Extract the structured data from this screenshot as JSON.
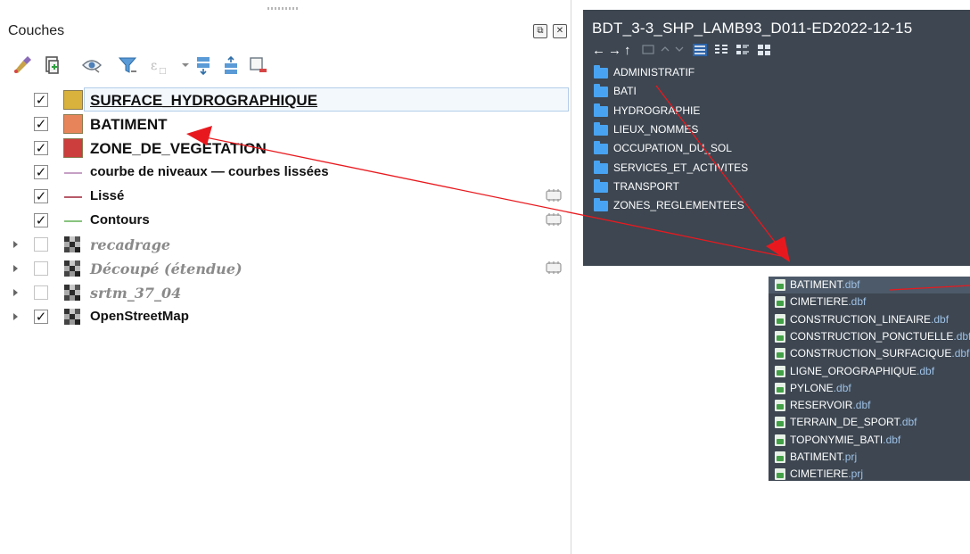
{
  "layers_panel": {
    "title": "Couches",
    "float_button": "⧉",
    "close_button": "✕",
    "layers": [
      {
        "name": "SURFACE_HYDROGRAPHIQUE",
        "checked": true,
        "symbol": "fill",
        "color": "#d8b23c",
        "underline": true,
        "selected": true,
        "expander": false,
        "edit": false
      },
      {
        "name": "BATIMENT",
        "checked": true,
        "symbol": "fill",
        "color": "#e8845a",
        "underline": false,
        "selected": false,
        "expander": false,
        "edit": false
      },
      {
        "name": "ZONE_DE_VEGETATION",
        "checked": true,
        "symbol": "fill",
        "color": "#cc3d3d",
        "underline": false,
        "selected": false,
        "expander": false,
        "edit": false
      },
      {
        "name": "courbe de niveaux — courbes lissées",
        "checked": true,
        "symbol": "line",
        "color": "#c6a0c4",
        "underline": false,
        "selected": false,
        "expander": false,
        "edit": false
      },
      {
        "name": "Lissé",
        "checked": true,
        "symbol": "line",
        "color": "#b85a6a",
        "underline": false,
        "selected": false,
        "expander": false,
        "edit": true
      },
      {
        "name": "Contours",
        "checked": true,
        "symbol": "line",
        "color": "#88c47e",
        "underline": false,
        "selected": false,
        "expander": false,
        "edit": true
      },
      {
        "name": "recadrage",
        "checked": false,
        "symbol": "raster",
        "color": "#555555",
        "underline": false,
        "selected": false,
        "expander": true,
        "edit": false
      },
      {
        "name": "Découpé (étendue)",
        "checked": false,
        "symbol": "raster",
        "color": "#555555",
        "underline": false,
        "selected": false,
        "expander": true,
        "edit": true
      },
      {
        "name": "srtm_37_04",
        "checked": false,
        "symbol": "raster",
        "color": "#555555",
        "underline": false,
        "selected": false,
        "expander": true,
        "edit": false
      },
      {
        "name": "OpenStreetMap",
        "checked": true,
        "symbol": "raster",
        "color": "#555555",
        "underline": false,
        "selected": false,
        "expander": true,
        "edit": false
      }
    ]
  },
  "explorer": {
    "path": "BDT_3-3_SHP_LAMB93_D011-ED2022-12-15",
    "nav": {
      "back": "←",
      "forward": "→",
      "up": "↑"
    },
    "folders": [
      "ADMINISTRATIF",
      "BATI",
      "HYDROGRAPHIE",
      "LIEUX_NOMMES",
      "OCCUPATION_DU_SOL",
      "SERVICES_ET_ACTIVITES",
      "TRANSPORT",
      "ZONES_REGLEMENTEES"
    ]
  },
  "file_list": {
    "files": [
      {
        "base": "BATIMENT",
        "ext": ".dbf"
      },
      {
        "base": "CIMETIERE",
        "ext": ".dbf"
      },
      {
        "base": "CONSTRUCTION_LINEAIRE",
        "ext": ".dbf"
      },
      {
        "base": "CONSTRUCTION_PONCTUELLE",
        "ext": ".dbf"
      },
      {
        "base": "CONSTRUCTION_SURFACIQUE",
        "ext": ".dbf"
      },
      {
        "base": "LIGNE_OROGRAPHIQUE",
        "ext": ".dbf"
      },
      {
        "base": "PYLONE",
        "ext": ".dbf"
      },
      {
        "base": "RESERVOIR",
        "ext": ".dbf"
      },
      {
        "base": "TERRAIN_DE_SPORT",
        "ext": ".dbf"
      },
      {
        "base": "TOPONYMIE_BATI",
        "ext": ".dbf"
      },
      {
        "base": "BATIMENT",
        "ext": ".prj"
      },
      {
        "base": "CIMETIERE",
        "ext": ".prj"
      }
    ]
  },
  "colors": {
    "arrow": "#e8191e",
    "explorer_bg": "#3d4651",
    "folder": "#48a3f2"
  }
}
